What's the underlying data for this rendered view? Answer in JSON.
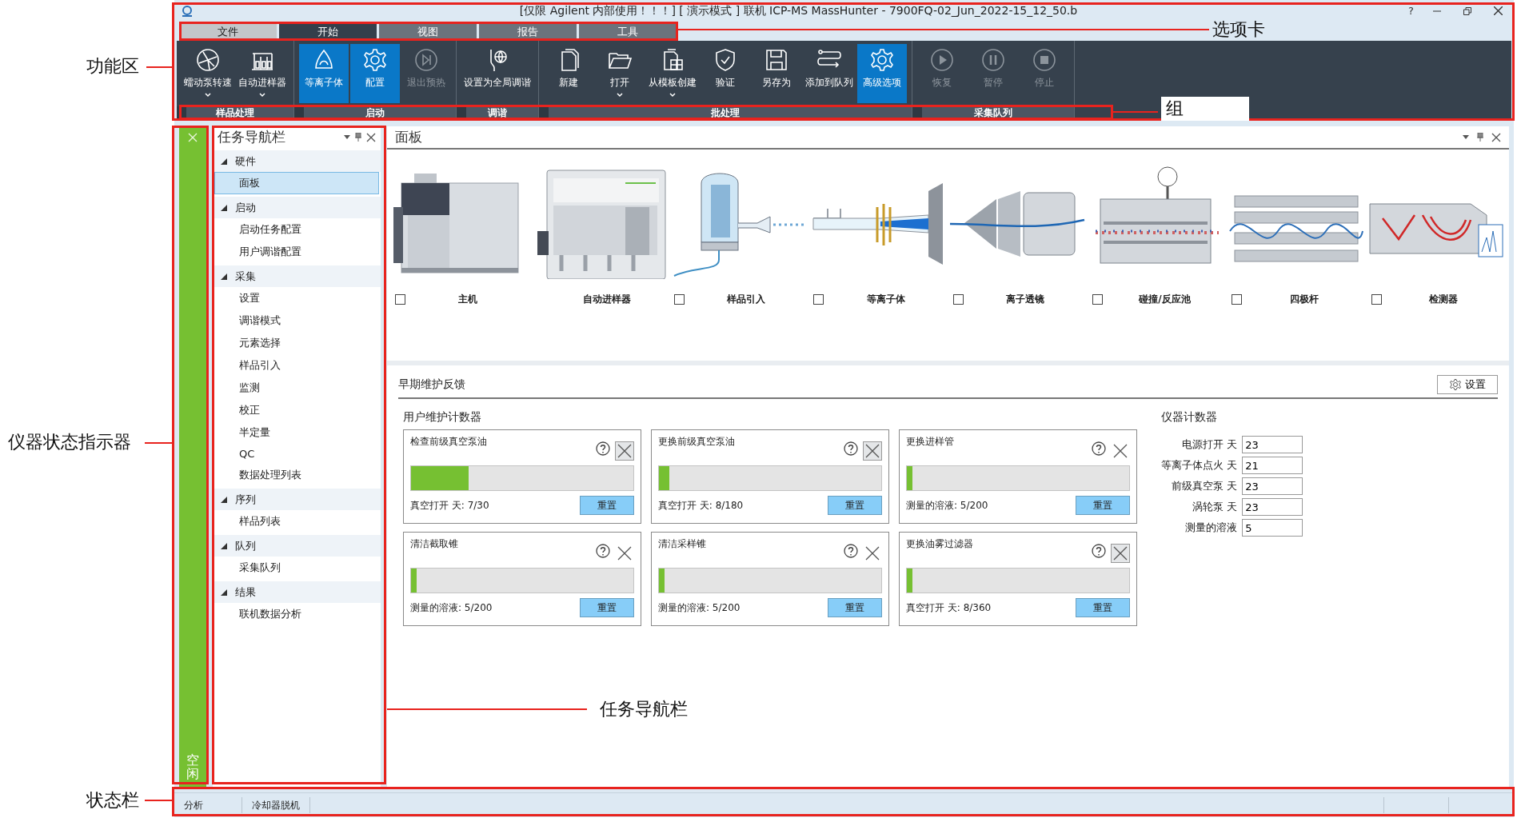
{
  "window": {
    "title": "[仅限 Agilent 内部使用！！！] [ 演示模式 ] 联机 ICP-MS MassHunter - 7900FQ-02_Jun_2022-15_12_50.b",
    "help": "?"
  },
  "tabs": [
    {
      "label": "文件",
      "kind": "file",
      "selected": false
    },
    {
      "label": "开始",
      "kind": "tab",
      "selected": true
    },
    {
      "label": "视图",
      "kind": "tab",
      "selected": false
    },
    {
      "label": "报告",
      "kind": "tab",
      "selected": false
    },
    {
      "label": "工具",
      "kind": "tab",
      "selected": false
    }
  ],
  "ribbon": {
    "groups": [
      {
        "label": "样品处理",
        "buttons": [
          {
            "label": "蠕动泵转速",
            "kind": "pump",
            "dropdown": true,
            "active": false,
            "disabled": false
          },
          {
            "label": "自动进样器",
            "kind": "autosampler",
            "dropdown": true,
            "active": false,
            "disabled": false
          }
        ]
      },
      {
        "label": "启动",
        "buttons": [
          {
            "label": "等离子体",
            "kind": "plasma",
            "dropdown": false,
            "active": true,
            "disabled": false
          },
          {
            "label": "配置",
            "kind": "gear",
            "dropdown": false,
            "active": true,
            "disabled": false
          },
          {
            "label": "退出预热",
            "kind": "skip",
            "dropdown": false,
            "active": false,
            "disabled": true
          }
        ]
      },
      {
        "label": "调谐",
        "buttons": [
          {
            "label": "设置为全局调谐",
            "kind": "tune",
            "dropdown": false,
            "active": false,
            "disabled": false
          }
        ]
      },
      {
        "label": "批处理",
        "buttons": [
          {
            "label": "新建",
            "kind": "new",
            "dropdown": false,
            "active": false,
            "disabled": false
          },
          {
            "label": "打开",
            "kind": "open",
            "dropdown": true,
            "active": false,
            "disabled": false
          },
          {
            "label": "从模板创建",
            "kind": "template",
            "dropdown": true,
            "active": false,
            "disabled": false
          },
          {
            "label": "验证",
            "kind": "validate",
            "dropdown": false,
            "active": false,
            "disabled": false
          },
          {
            "label": "另存为",
            "kind": "save",
            "dropdown": false,
            "active": false,
            "disabled": false
          },
          {
            "label": "添加到队列",
            "kind": "queue",
            "dropdown": false,
            "active": false,
            "disabled": false
          },
          {
            "label": "高级选项",
            "kind": "gear",
            "dropdown": false,
            "active": true,
            "disabled": false
          }
        ]
      },
      {
        "label": "采集队列",
        "buttons": [
          {
            "label": "恢复",
            "kind": "play",
            "dropdown": false,
            "active": false,
            "disabled": true
          },
          {
            "label": "暂停",
            "kind": "pause",
            "dropdown": false,
            "active": false,
            "disabled": true
          },
          {
            "label": "停止",
            "kind": "stop",
            "dropdown": false,
            "active": false,
            "disabled": true
          }
        ]
      }
    ]
  },
  "status_indicator": {
    "color": "#76c032",
    "label": "空闲"
  },
  "task_navigator": {
    "title": "任务导航栏",
    "groups": [
      {
        "label": "硬件",
        "expanded": true,
        "children": [
          {
            "label": "面板",
            "selected": true
          }
        ]
      },
      {
        "label": "启动",
        "expanded": true,
        "children": [
          {
            "label": "启动任务配置",
            "selected": false
          },
          {
            "label": "用户调谐配置",
            "selected": false
          }
        ]
      },
      {
        "label": "采集",
        "expanded": true,
        "children": [
          {
            "label": "设置",
            "selected": false
          },
          {
            "label": "调谐模式",
            "selected": false
          },
          {
            "label": "元素选择",
            "selected": false
          },
          {
            "label": "样品引入",
            "selected": false
          },
          {
            "label": "监测",
            "selected": false
          },
          {
            "label": "校正",
            "selected": false
          },
          {
            "label": "半定量",
            "selected": false
          },
          {
            "label": "QC",
            "selected": false
          },
          {
            "label": "数据处理列表",
            "selected": false
          }
        ]
      },
      {
        "label": "序列",
        "expanded": true,
        "children": [
          {
            "label": "样品列表",
            "selected": false
          }
        ]
      },
      {
        "label": "队列",
        "expanded": true,
        "children": [
          {
            "label": "采集队列",
            "selected": false
          }
        ]
      },
      {
        "label": "结果",
        "expanded": true,
        "children": [
          {
            "label": "联机数据分析",
            "selected": false
          }
        ]
      }
    ]
  },
  "panel": {
    "title": "面板",
    "modules": [
      {
        "label": "主机",
        "kind": "mainframe",
        "checked": false
      },
      {
        "label": "自动进样器",
        "kind": "autosampler"
      },
      {
        "label": "样品引入",
        "kind": "nebulizer",
        "checked": false
      },
      {
        "label": "等离子体",
        "kind": "torch",
        "checked": false
      },
      {
        "label": "离子透镜",
        "kind": "lens",
        "checked": false
      },
      {
        "label": "碰撞/反应池",
        "kind": "cell",
        "checked": false
      },
      {
        "label": "四极杆",
        "kind": "quadrupole",
        "checked": false
      },
      {
        "label": "检测器",
        "kind": "detector",
        "checked": false
      }
    ],
    "maintenance": {
      "title": "早期维护反馈",
      "settings_button": "设置",
      "user_counters": {
        "title": "用户维护计数器",
        "cards": [
          {
            "title": "检查前级真空泵油",
            "level": 0.26,
            "reading": "真空打开 天: 7/30",
            "dismiss_highlighted": true,
            "reset": "重置"
          },
          {
            "title": "更换前级真空泵油",
            "level": 0.045,
            "reading": "真空打开 天: 8/180",
            "dismiss_highlighted": true,
            "reset": "重置"
          },
          {
            "title": "更换进样管",
            "level": 0.025,
            "reading": "测量的溶液: 5/200",
            "dismiss_highlighted": false,
            "reset": "重置"
          },
          {
            "title": "清洁截取锥",
            "level": 0.025,
            "reading": "测量的溶液: 5/200",
            "dismiss_highlighted": false,
            "reset": "重置"
          },
          {
            "title": "清洁采样锥",
            "level": 0.025,
            "reading": "测量的溶液: 5/200",
            "dismiss_highlighted": false,
            "reset": "重置"
          },
          {
            "title": "更换油雾过滤器",
            "level": 0.025,
            "reading": "真空打开 天: 8/360",
            "dismiss_highlighted": true,
            "reset": "重置"
          }
        ]
      },
      "instrument_counters": {
        "title": "仪器计数器",
        "rows": [
          {
            "label": "电源打开 天",
            "value": "23"
          },
          {
            "label": "等离子体点火 天",
            "value": "21"
          },
          {
            "label": "前级真空泵 天",
            "value": "23"
          },
          {
            "label": "涡轮泵 天",
            "value": "23"
          },
          {
            "label": "测量的溶液",
            "value": "5"
          }
        ]
      }
    }
  },
  "status_bar": [
    {
      "text": "分析"
    },
    {
      "text": "冷却器脱机"
    }
  ],
  "annotations": [
    {
      "label": "功能区"
    },
    {
      "label": "选项卡"
    },
    {
      "label": "组"
    },
    {
      "label": "仪器状态指示器"
    },
    {
      "label": "任务导航栏"
    },
    {
      "label": "状态栏"
    }
  ]
}
